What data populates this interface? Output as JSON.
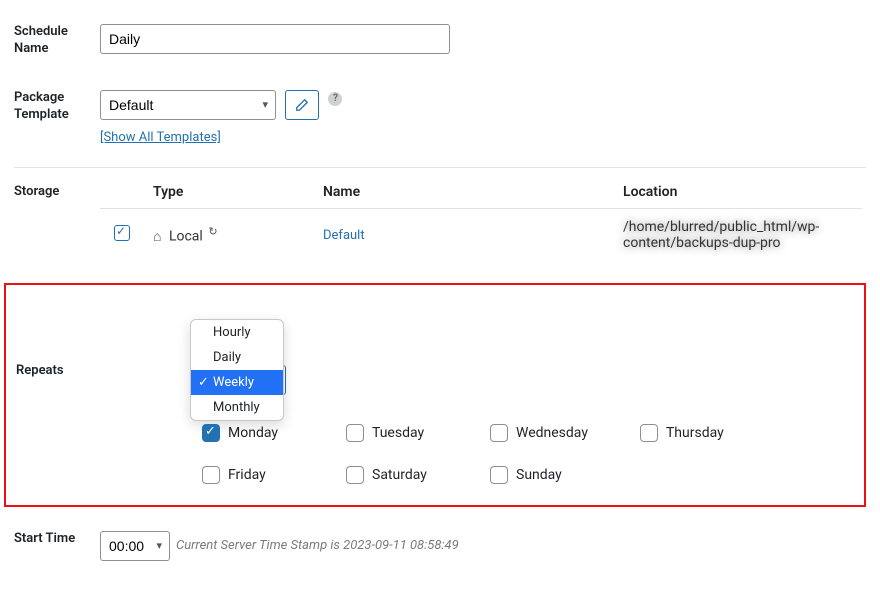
{
  "schedule": {
    "name_label": "Schedule Name",
    "name_value": "Daily"
  },
  "package": {
    "label": "Package Template",
    "selected": "Default",
    "show_all": "[Show All Templates]",
    "help_tip": "?"
  },
  "storage": {
    "label": "Storage",
    "headers": {
      "type": "Type",
      "name": "Name",
      "location": "Location"
    },
    "row": {
      "checked": true,
      "type": "Local",
      "name": "Default",
      "location": "/home/blurred/public_html/wp-content/backups-dup-pro"
    }
  },
  "repeats": {
    "label": "Repeats",
    "options": [
      "Hourly",
      "Daily",
      "Weekly",
      "Monthly"
    ],
    "selected": "Weekly",
    "days": {
      "monday": {
        "label": "Monday",
        "checked": true
      },
      "tuesday": {
        "label": "Tuesday",
        "checked": false
      },
      "wednesday": {
        "label": "Wednesday",
        "checked": false
      },
      "thursday": {
        "label": "Thursday",
        "checked": false
      },
      "friday": {
        "label": "Friday",
        "checked": false
      },
      "saturday": {
        "label": "Saturday",
        "checked": false
      },
      "sunday": {
        "label": "Sunday",
        "checked": false
      }
    }
  },
  "start": {
    "label": "Start Time",
    "value": "00:00",
    "hint_prefix": "Current Server Time Stamp is  ",
    "timestamp": "2023-09-11 08:58:49"
  }
}
